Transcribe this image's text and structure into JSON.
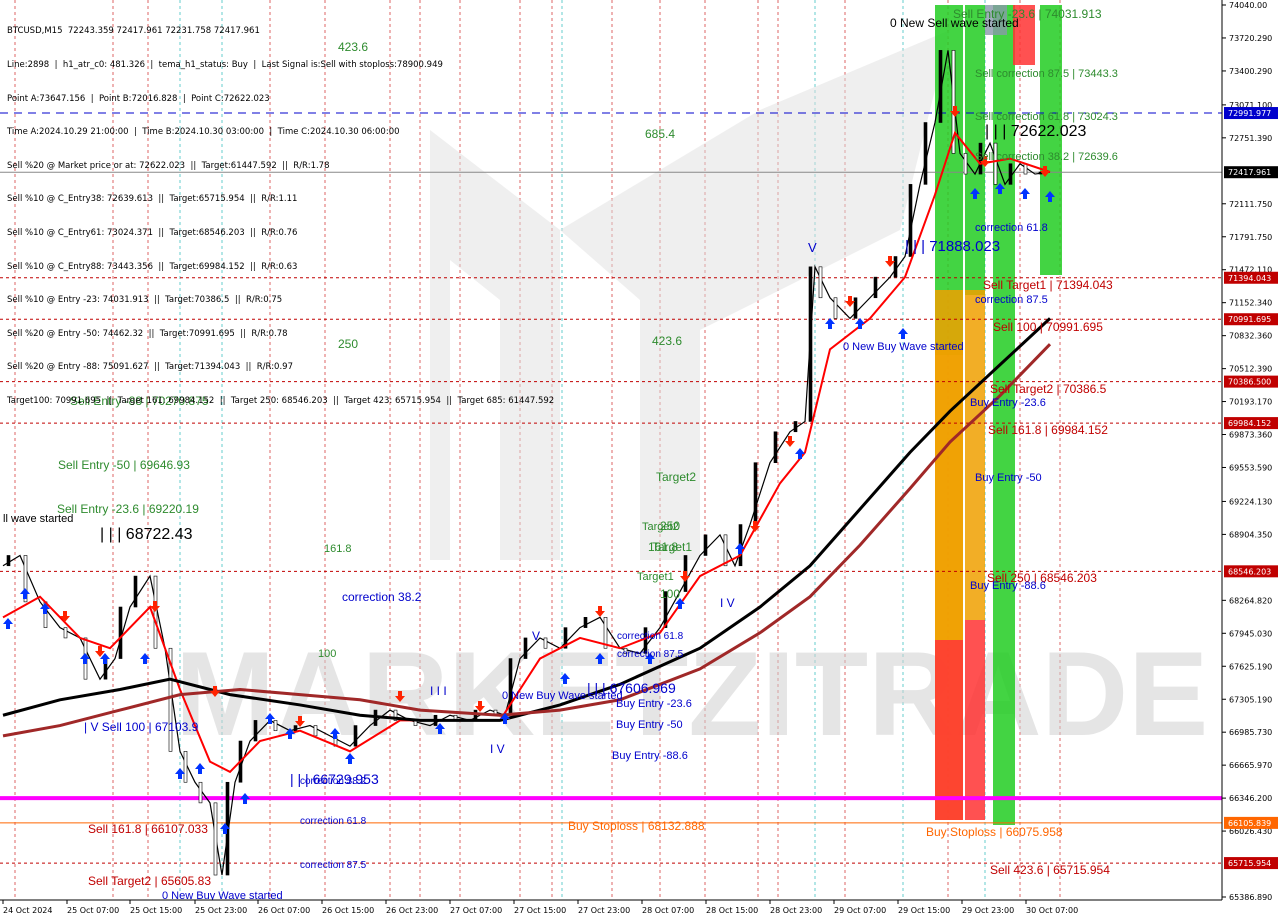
{
  "symbol_header": "BTCUSD,M15  72243.359 72417.961 72231.758 72417.961",
  "info_lines": [
    "Line:2898  |  h1_atr_c0: 481.326  |  tema_h1_status: Buy  |  Last Signal is:Sell with stoploss:78900.949",
    "Point A:73647.156  |  Point B:72016.828  |  Point C:72622.023",
    "Time A:2024.10.29 21:00:00  |  Time B:2024.10.30 03:00:00  |  Time C:2024.10.30 06:00:00",
    "Sell %20 @ Market price or at: 72622.023  ||  Target:61447.592  ||  R/R:1.78",
    "Sell %10 @ C_Entry38: 72639.613  ||  Target:65715.954  ||  R/R:1.11",
    "Sell %10 @ C_Entry61: 73024.371  ||  Target:68546.203  ||  R/R:0.76",
    "Sell %10 @ C_Entry88: 73443.356  ||  Target:69984.152  ||  R/R:0.63",
    "Sell %10 @ Entry -23: 74031.913  ||  Target:70386.5  ||  R/R:0.75",
    "Sell %20 @ Entry -50: 74462.32  ||  Target:70991.695  ||  R/R:0.78",
    "Sell %20 @ Entry -88: 75091.627  ||  Target:71394.043  ||  R/R:0.97",
    "Target100: 70991.695  ||  Target 161: 69984.152  ||  Target 250: 68546.203  ||  Target 423: 65715.954  ||  Target 685: 61447.592"
  ],
  "price_axis_labels": [
    "74040.00",
    "73720.290",
    "73400.290",
    "73071.100",
    "72751.390",
    "72111.750",
    "71791.750",
    "71472.110",
    "71152.340",
    "70832.360",
    "70512.390",
    "70193.170",
    "69873.360",
    "69553.590",
    "69224.130",
    "68904.350",
    "68264.820",
    "67945.030",
    "67625.190",
    "67305.190",
    "66985.730",
    "66665.970",
    "66346.200",
    "66026.430",
    "65386.890"
  ],
  "price_tags": [
    {
      "text": "72991.977",
      "color": "#0000cc",
      "price": 72991.977
    },
    {
      "text": "72417.961",
      "color": "#000000",
      "price": 72417.961
    },
    {
      "text": "71394.043",
      "color": "#c00000",
      "price": 71394.043
    },
    {
      "text": "70991.695",
      "color": "#c00000",
      "price": 70991.695
    },
    {
      "text": "70386.500",
      "color": "#c00000",
      "price": 70386.5
    },
    {
      "text": "69984.152",
      "color": "#c00000",
      "price": 69984.152
    },
    {
      "text": "68546.203",
      "color": "#c00000",
      "price": 68546.203
    },
    {
      "text": "66105.839",
      "color": "#ff6600",
      "price": 66105.839
    },
    {
      "text": "65715.954",
      "color": "#c00000",
      "price": 65715.954
    }
  ],
  "time_labels": [
    "24 Oct 2024",
    "25 Oct 07:00",
    "25 Oct 15:00",
    "25 Oct 23:00",
    "26 Oct 07:00",
    "26 Oct 15:00",
    "26 Oct 23:00",
    "27 Oct 07:00",
    "27 Oct 15:00",
    "27 Oct 23:00",
    "28 Oct 07:00",
    "28 Oct 15:00",
    "28 Oct 23:00",
    "29 Oct 07:00",
    "29 Oct 15:00",
    "29 Oct 23:00",
    "30 Oct 07:00"
  ],
  "chart_labels": [
    {
      "t": "Sell Entry -23.6 | 74031.913",
      "c": "#2e8b2e"
    },
    {
      "t": "0 New Sell wave started",
      "c": "#000000"
    },
    {
      "t": "Sell correction 87.5 | 73443.3",
      "c": "#2e8b2e"
    },
    {
      "t": "Sell correction 61.8 | 73024.3",
      "c": "#2e8b2e"
    },
    {
      "t": "| | | 72622.023",
      "c": "#000000"
    },
    {
      "t": "Sell correction 38.2 | 72639.6",
      "c": "#2e8b2e"
    },
    {
      "t": "correction 61.8",
      "c": "#0000cc"
    },
    {
      "t": "| | | 71888.023",
      "c": "#0000cc"
    },
    {
      "t": "Sell Target1 | 71394.043",
      "c": "#c00000"
    },
    {
      "t": "correction 87.5",
      "c": "#0000cc"
    },
    {
      "t": "Sell 100 | 70991.695",
      "c": "#c00000"
    },
    {
      "t": "0 New Buy Wave started",
      "c": "#0000cc"
    },
    {
      "t": "Sell Target2 | 70386.5",
      "c": "#c00000"
    },
    {
      "t": "Buy Entry -23.6",
      "c": "#0000cc"
    },
    {
      "t": "Sell 161.8 | 69984.152",
      "c": "#c00000"
    },
    {
      "t": "Buy Entry -50",
      "c": "#0000cc"
    },
    {
      "t": "Sell 250 | 68546.203",
      "c": "#c00000"
    },
    {
      "t": "Buy Entry -88.6",
      "c": "#0000cc"
    },
    {
      "t": "Buy Stoploss | 66075.958",
      "c": "#ff6600"
    },
    {
      "t": "Sell 423.6 | 65715.954",
      "c": "#c00000"
    },
    {
      "t": "685.4",
      "c": "#2e8b2e"
    },
    {
      "t": "423.6",
      "c": "#2e8b2e"
    },
    {
      "t": "250",
      "c": "#2e8b2e"
    },
    {
      "t": "Target2",
      "c": "#2e8b2e"
    },
    {
      "t": "161.8",
      "c": "#2e8b2e"
    },
    {
      "t": "Target1",
      "c": "#2e8b2e"
    },
    {
      "t": "100",
      "c": "#2e8b2e"
    },
    {
      "t": "correction 38.2",
      "c": "#0000cc"
    },
    {
      "t": "correction 61.8",
      "c": "#0000cc"
    },
    {
      "t": "correction 87.5",
      "c": "#0000cc"
    },
    {
      "t": "0 New Buy Wave started",
      "c": "#0000cc"
    },
    {
      "t": "| | | 67606.969",
      "c": "#0000cc"
    },
    {
      "t": "Buy Entry -23.6",
      "c": "#0000cc"
    },
    {
      "t": "Buy Entry -50",
      "c": "#0000cc"
    },
    {
      "t": "Buy Entry -88.6",
      "c": "#0000cc"
    },
    {
      "t": "Buy Stoploss | 68132.888",
      "c": "#ff6600"
    },
    {
      "t": "423.6",
      "c": "#2e8b2e"
    },
    {
      "t": "250",
      "c": "#2e8b2e"
    },
    {
      "t": "161.8",
      "c": "#2e8b2e"
    },
    {
      "t": "Target2",
      "c": "#2e8b2e"
    },
    {
      "t": "100",
      "c": "#2e8b2e"
    },
    {
      "t": "Target1",
      "c": "#2e8b2e"
    },
    {
      "t": "Sell Entry -88 | 70270.875",
      "c": "#2e8b2e"
    },
    {
      "t": "Sell Entry -50 | 69646.93",
      "c": "#2e8b2e"
    },
    {
      "t": "Sell Entry -23.6 | 69220.19",
      "c": "#2e8b2e"
    },
    {
      "t": "| | | 68722.43",
      "c": "#000000"
    },
    {
      "t": "ll wave started",
      "c": "#000000"
    },
    {
      "t": "| V Sell 100 | 67103.9",
      "c": "#0000cc"
    },
    {
      "t": "| | | 66729.953",
      "c": "#0000cc"
    },
    {
      "t": "correction 38.2",
      "c": "#0000cc"
    },
    {
      "t": "correction 61.8",
      "c": "#0000cc"
    },
    {
      "t": "correction 87.5",
      "c": "#0000cc"
    },
    {
      "t": "Sell 161.8 | 66107.033",
      "c": "#c00000"
    },
    {
      "t": "Sell Target2 | 65605.83",
      "c": "#c00000"
    },
    {
      "t": "0 New Buy Wave started",
      "c": "#0000cc"
    },
    {
      "t": "I V",
      "c": "#0000cc"
    },
    {
      "t": "I V",
      "c": "#0000cc"
    },
    {
      "t": "V",
      "c": "#0000cc"
    },
    {
      "t": "V",
      "c": "#0000cc"
    },
    {
      "t": "I I I",
      "c": "#0000cc"
    }
  ],
  "watermark": "MARKETZITRADE",
  "colors": {
    "green": "#22cc22",
    "orange": "#f0a000",
    "red": "#ff3333",
    "magenta": "#ff00ff",
    "ma_black": "#000000",
    "ma_darkred": "#a02828",
    "price_line": "#ff0000"
  }
}
